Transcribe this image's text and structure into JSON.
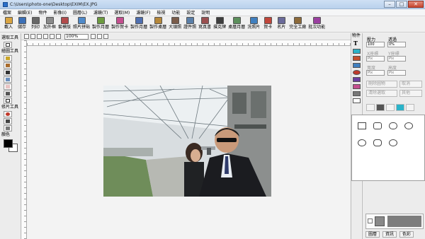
{
  "window": {
    "title": "C:\\Users\\photo-one\\Desktop\\EXIM\\EX.JPG"
  },
  "menu": [
    "檔案",
    "編輯(E)",
    "物件",
    "影像(I)",
    "圖層(L)",
    "濾鏡(T)",
    "選取(M)",
    "濾鏡(F)",
    "檢視",
    "功能",
    "設定",
    "說明"
  ],
  "toolbar": [
    {
      "label": "載入",
      "icon": "open-folder-icon",
      "color": "#d9a441"
    },
    {
      "label": "儲存",
      "icon": "save-icon",
      "color": "#3b6fb6"
    },
    {
      "label": "列印",
      "icon": "print-icon",
      "color": "#666666"
    },
    {
      "label": "加外框",
      "icon": "frame-icon",
      "color": "#8a8a8a"
    },
    {
      "label": "套模版",
      "icon": "template-icon",
      "color": "#b24b4b"
    },
    {
      "label": "照片拼貼",
      "icon": "collage-icon",
      "color": "#4f8ac9"
    },
    {
      "label": "製作月曆",
      "icon": "calendar-icon",
      "color": "#6c9b3f"
    },
    {
      "label": "製作賀卡",
      "icon": "greeting-card-icon",
      "color": "#c44f8f"
    },
    {
      "label": "製作月曆",
      "icon": "calendar-icon",
      "color": "#4f6fb0"
    },
    {
      "label": "製作桌曆",
      "icon": "desk-calendar-icon",
      "color": "#b5873a"
    },
    {
      "label": "大頭照",
      "icon": "portrait-icon",
      "color": "#7a5c4a"
    },
    {
      "label": "證件照",
      "icon": "id-photo-icon",
      "color": "#5a7fa8"
    },
    {
      "label": "寫真書",
      "icon": "photobook-icon",
      "color": "#9a4f4f"
    },
    {
      "label": "撲克牌",
      "icon": "playing-card-icon",
      "color": "#3d3d3d"
    },
    {
      "label": "桌曆月曆",
      "icon": "desk-calendar-icon",
      "color": "#5c8f5c"
    },
    {
      "label": "洗照片",
      "icon": "print-photo-icon",
      "color": "#3f7fbf"
    },
    {
      "label": "賀卡",
      "icon": "card-icon",
      "color": "#c0453a"
    },
    {
      "label": "名片",
      "icon": "name-card-icon",
      "color": "#6a6a9a"
    },
    {
      "label": "完全工廠",
      "icon": "factory-icon",
      "color": "#8c6a3a"
    },
    {
      "label": "批次功能",
      "icon": "batch-icon",
      "color": "#9a3fa0"
    }
  ],
  "optionbar": {
    "zoom": "100%"
  },
  "left_panel": {
    "select_title": "選取工具",
    "draw_title": "繪圖工具",
    "edit_title": "修片工具",
    "color_title": "顏色",
    "fg_color": "#000000",
    "bg_color": "#ffffff"
  },
  "right_strip": {
    "title": "物件"
  },
  "right_panel": {
    "size_label": "壓力",
    "transparent_label": "透過",
    "size_value": "100",
    "transparent_value": "0%",
    "x_label": "X座標",
    "y_label": "Y座標",
    "width_label": "寬度",
    "height_label": "高度",
    "unit": "Pix",
    "btn_delete_all": "刪除圖物",
    "btn_select": "取消",
    "btn_clear": "清除選取",
    "btn_other": "其他"
  },
  "tabs": [
    "圖層",
    "資訊",
    "色彩"
  ]
}
